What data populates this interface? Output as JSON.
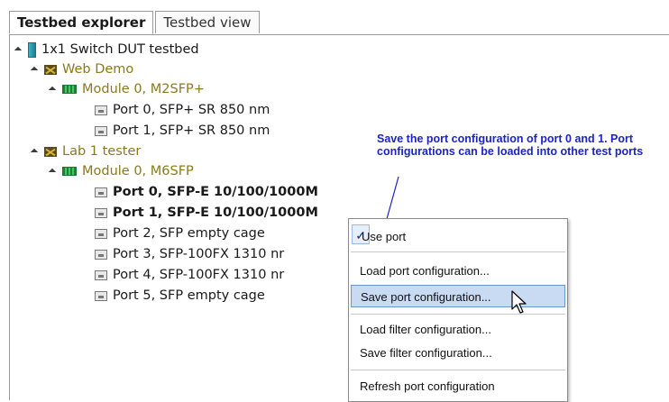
{
  "tabs": [
    {
      "label": "Testbed explorer",
      "active": true
    },
    {
      "label": "Testbed view",
      "active": false
    }
  ],
  "tree": {
    "testbed": "1x1 Switch DUT testbed",
    "chassis1": {
      "label": "Web Demo",
      "module": "Module 0, M2SFP+",
      "ports": [
        "Port 0, SFP+ SR 850 nm",
        "Port 1, SFP+ SR 850 nm"
      ]
    },
    "chassis2": {
      "label": "Lab 1 tester",
      "module": "Module 0, M6SFP",
      "ports": [
        "Port 0, SFP-E 10/100/1000M",
        "Port 1, SFP-E 10/100/1000M",
        "Port 2, SFP empty cage",
        "Port 3, SFP-100FX 1310 nr",
        "Port 4, SFP-100FX 1310 nr",
        "Port 5, SFP empty cage"
      ]
    }
  },
  "annotation": {
    "text": "Save the port configuration of port 0 and 1. Port configurations can be loaded into other test ports"
  },
  "context_menu": {
    "items": [
      {
        "label": "Use port",
        "checked": true
      },
      {
        "label": "Load port configuration..."
      },
      {
        "label": "Save port configuration...",
        "highlighted": true
      },
      {
        "label": "Load filter configuration..."
      },
      {
        "label": "Save filter configuration..."
      },
      {
        "label": "Refresh port configuration"
      }
    ]
  },
  "colors": {
    "annotation": "#1d23c8",
    "chassis_text": "#8a7a1c",
    "menu_highlight": "#c9daf3"
  },
  "icons": {
    "testbed": "testbed-icon",
    "chassis": "chassis-icon",
    "module": "module-icon",
    "port": "port-icon",
    "check": "check-icon",
    "cursor": "mouse-cursor-icon"
  }
}
